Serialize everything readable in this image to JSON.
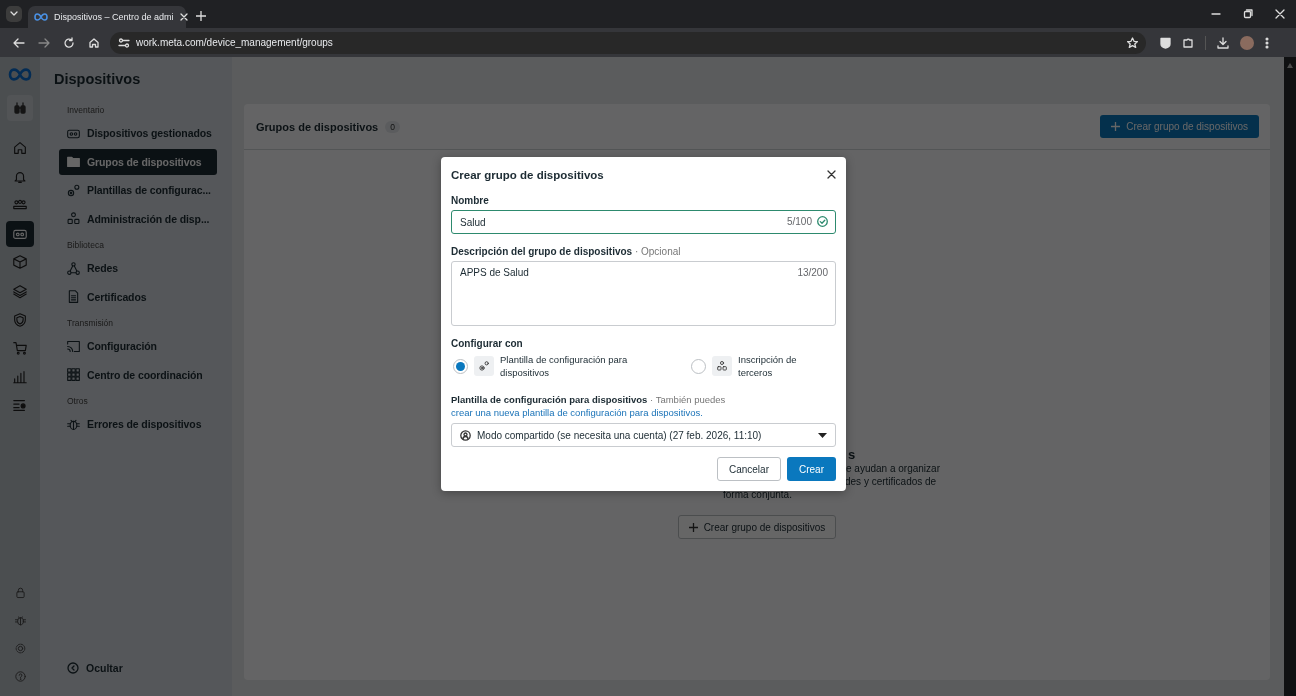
{
  "browser": {
    "tabs": [
      {
        "title": "Dispositivos – Centro de admi",
        "selected": true
      }
    ],
    "address": "work.meta.com/device_management/groups"
  },
  "rail": {
    "items": [
      {
        "kind": "home",
        "selected": false
      },
      {
        "kind": "bell",
        "selected": false
      },
      {
        "kind": "people",
        "selected": false
      },
      {
        "kind": "headset",
        "selected": true
      },
      {
        "kind": "box",
        "selected": false
      },
      {
        "kind": "layers",
        "selected": false
      },
      {
        "kind": "shield",
        "selected": false
      },
      {
        "kind": "cart",
        "selected": false
      },
      {
        "kind": "chart",
        "selected": false
      },
      {
        "kind": "settings",
        "selected": false
      }
    ],
    "bottom": [
      {
        "kind": "lock"
      },
      {
        "kind": "bug"
      },
      {
        "kind": "gear"
      },
      {
        "kind": "help"
      }
    ]
  },
  "sidebar": {
    "title": "Dispositivos",
    "sections": [
      {
        "heading": "Inventario",
        "items": [
          {
            "kind": "headset",
            "label": "Dispositivos gestionados",
            "selected": false
          },
          {
            "kind": "folder",
            "label": "Grupos de dispositivos",
            "selected": true
          },
          {
            "kind": "gears",
            "label": "Plantillas de configurac...",
            "selected": false
          },
          {
            "kind": "nodes",
            "label": "Administración de disp...",
            "selected": false
          }
        ]
      },
      {
        "heading": "Biblioteca",
        "items": [
          {
            "kind": "network",
            "label": "Redes",
            "selected": false
          },
          {
            "kind": "document",
            "label": "Certificados",
            "selected": false
          }
        ]
      },
      {
        "heading": "Transmisión",
        "items": [
          {
            "kind": "cast",
            "label": "Configuración",
            "selected": false
          },
          {
            "kind": "grid",
            "label": "Centro de coordinación",
            "selected": false
          }
        ]
      },
      {
        "heading": "Otros",
        "items": [
          {
            "kind": "bug",
            "label": "Errores de dispositivos",
            "selected": false
          }
        ]
      }
    ],
    "footer": "Ocultar"
  },
  "main": {
    "title": "Grupos de dispositivos",
    "count": "0",
    "create_button": "Crear grupo de dispositivos",
    "empty_state": {
      "heading": "s",
      "lines": [
        "e ayudan a organizar",
        "des y certificados de",
        "forma conjunta."
      ],
      "button": "Crear grupo de dispositivos"
    }
  },
  "modal": {
    "title": "Crear grupo de dispositivos",
    "name_label": "Nombre",
    "name_value": "Salud",
    "name_counter": "5/100",
    "name_valid": true,
    "description_label": "Descripción del grupo de dispositivos",
    "optional": "· Opcional",
    "description_value": "APPS de Salud",
    "description_counter": "13/200",
    "configure_label": "Configurar con",
    "options": [
      {
        "kind": "gears",
        "label": "Plantilla de configuración para dispositivos",
        "selected": true
      },
      {
        "kind": "nodes",
        "label": "Inscripción de terceros",
        "selected": false
      }
    ],
    "template_label": "**Plantilla de configuración para dispositivos** · También puedes",
    "template_link": "crear una nueva plantilla de configuración para dispositivos.",
    "template_value": "Modo compartido (se necesita una cuenta) (27 feb. 2026, 11:10)",
    "cancel": "Cancelar",
    "submit": "Crear"
  }
}
